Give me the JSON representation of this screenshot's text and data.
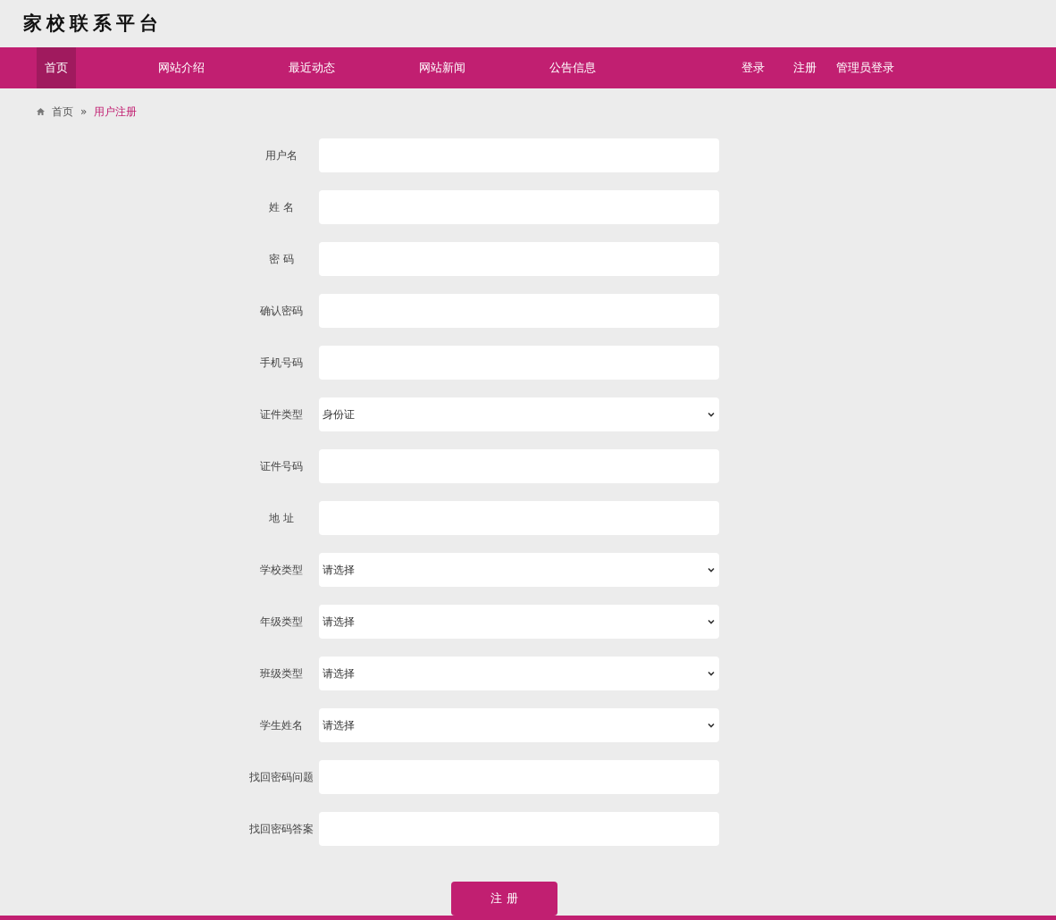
{
  "site_title": "家校联系平台",
  "nav": {
    "left": [
      {
        "label": "首页",
        "selected": true
      },
      {
        "label": "网站介绍",
        "selected": false
      },
      {
        "label": "最近动态",
        "selected": false
      },
      {
        "label": "网站新闻",
        "selected": false
      },
      {
        "label": "公告信息",
        "selected": false
      }
    ],
    "right": [
      {
        "label": "登录",
        "selected": false
      },
      {
        "label": "注册",
        "selected": false
      },
      {
        "label": "管理员登录",
        "selected": false
      }
    ]
  },
  "breadcrumb": {
    "home": "首页",
    "separator": "»",
    "current": "用户注册"
  },
  "form": {
    "fields": [
      {
        "label": "用户名",
        "kind": "text"
      },
      {
        "label": "姓 名",
        "kind": "text"
      },
      {
        "label": "密 码",
        "kind": "text"
      },
      {
        "label": "确认密码",
        "kind": "text"
      },
      {
        "label": "手机号码",
        "kind": "text"
      },
      {
        "label": "证件类型",
        "kind": "select",
        "value": "身份证"
      },
      {
        "label": "证件号码",
        "kind": "text"
      },
      {
        "label": "地 址",
        "kind": "text"
      },
      {
        "label": "学校类型",
        "kind": "select",
        "value": "请选择"
      },
      {
        "label": "年级类型",
        "kind": "select",
        "value": "请选择"
      },
      {
        "label": "班级类型",
        "kind": "select",
        "value": "请选择"
      },
      {
        "label": "学生姓名",
        "kind": "select",
        "value": "请选择"
      },
      {
        "label": "找回密码问题",
        "kind": "text"
      },
      {
        "label": "找回密码答案",
        "kind": "text"
      }
    ],
    "submit": "注 册"
  }
}
